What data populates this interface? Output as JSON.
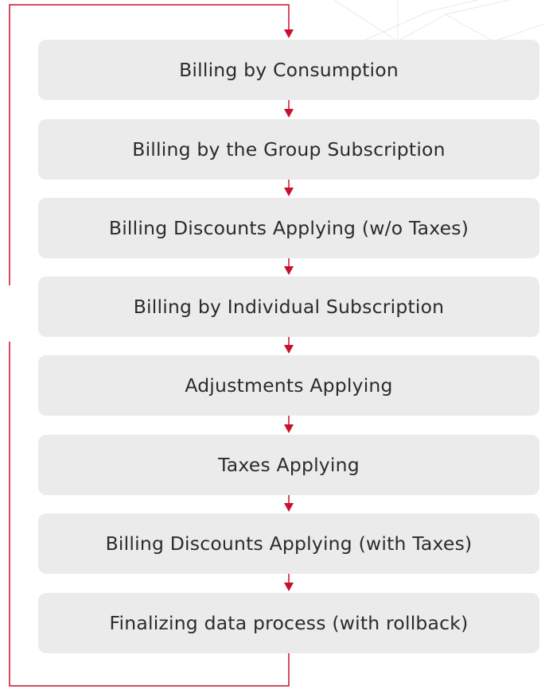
{
  "colors": {
    "box_fill": "#ebebeb",
    "text": "#2b2b2b",
    "connector": "#c8102e",
    "background_lines": "#e6e6e6"
  },
  "steps": [
    {
      "label": "Billing by Consumption"
    },
    {
      "label": "Billing by the Group Subscription"
    },
    {
      "label": "Billing Discounts Applying (w/o Taxes)"
    },
    {
      "label": "Billing by Individual Subscription"
    },
    {
      "label": "Adjustments Applying"
    },
    {
      "label": "Taxes Applying"
    },
    {
      "label": "Billing Discounts Applying (with Taxes)"
    },
    {
      "label": "Finalizing data process (with rollback)"
    }
  ],
  "icons": {
    "arrow": "arrow-down-icon",
    "loop_bracket": "loop-bracket"
  }
}
